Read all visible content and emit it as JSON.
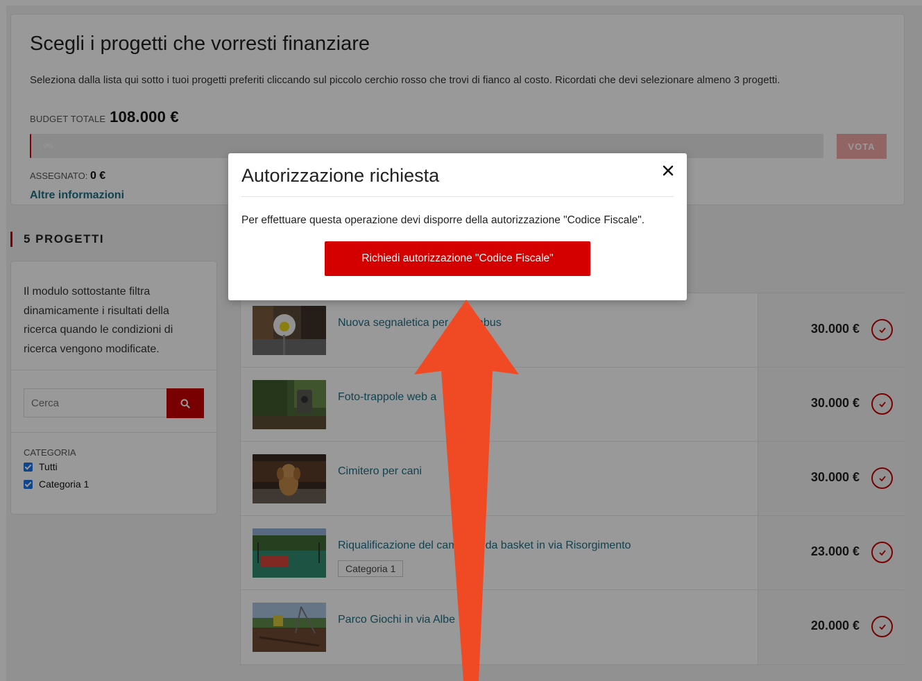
{
  "header": {
    "title": "Scegli i progetti che vorresti finanziare",
    "subtitle": "Seleziona dalla lista qui sotto i tuoi progetti preferiti cliccando sul piccolo cerchio rosso che trovi di fianco al costo. Ricordati che devi selezionare almeno 3 progetti.",
    "budget_label": "BUDGET TOTALE",
    "budget_value": "108.000 €",
    "progress_text": "0%",
    "progress_value": 0,
    "vote_label": "VOTA",
    "assigned_label": "ASSEGNATO:",
    "assigned_value": "0 €",
    "more_info": "Altre informazioni"
  },
  "projects_section": {
    "title": "5 PROGETTI"
  },
  "sidebar": {
    "description": "Il modulo sottostante filtra dinamicamente i risultati della ricerca quando le condizioni di ricerca vengono modificate.",
    "search_placeholder": "Cerca",
    "search_icon": "search-icon",
    "category_label": "CATEGORIA",
    "categories": [
      {
        "label": "Tutti",
        "checked": true
      },
      {
        "label": "Categoria 1",
        "checked": true
      }
    ]
  },
  "projects": [
    {
      "title": "Nuova segnaletica per scuolabus",
      "price": "30.000 €",
      "tag": ""
    },
    {
      "title": "Foto-trappole web a",
      "price": "30.000 €",
      "tag": ""
    },
    {
      "title": "Cimitero per cani",
      "price": "30.000 €",
      "tag": ""
    },
    {
      "title": "Riqualificazione del campetto da basket in via Risorgimento",
      "price": "23.000 €",
      "tag": "Categoria 1"
    },
    {
      "title": "Parco Giochi in via Albe",
      "price": "20.000 €",
      "tag": ""
    }
  ],
  "modal": {
    "title": "Autorizzazione richiesta",
    "close_icon": "close-icon",
    "text": "Per effettuare questa operazione devi disporre della autorizzazione \"Codice Fiscale\".",
    "button_label": "Richiedi autorizzazione \"Codice Fiscale\""
  },
  "colors": {
    "accent_red": "#d40000",
    "link_teal": "#1d6f85",
    "annotation_arrow": "#f04a25"
  }
}
